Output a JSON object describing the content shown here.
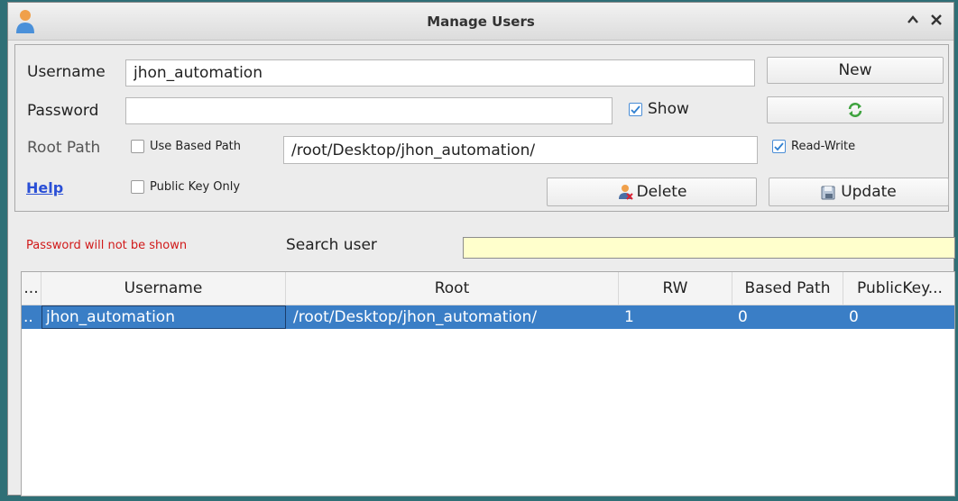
{
  "window": {
    "title": "Manage Users",
    "controls": {
      "shade": "^",
      "close": "x"
    }
  },
  "form": {
    "username_label": "Username",
    "username_value": "jhon_automation",
    "password_label": "Password",
    "password_value": "",
    "show_label": "Show",
    "show_checked": true,
    "root_path_label": "Root Path",
    "use_based_path_label": "Use Based Path",
    "use_based_path_checked": false,
    "root_path_value": "/root/Desktop/jhon_automation/",
    "read_write_label": "Read-Write",
    "read_write_checked": true,
    "public_key_only_label": "Public Key Only",
    "public_key_only_checked": false,
    "help_label": "Help"
  },
  "buttons": {
    "new_label": "New",
    "refresh_icon": "refresh-icon",
    "delete_label": "Delete",
    "update_label": "Update"
  },
  "search": {
    "warning": "Password will not be shown",
    "label": "Search user",
    "value": ""
  },
  "table": {
    "columns": [
      "...",
      "Username",
      "Root",
      "RW",
      "Based Path",
      "PublicKey..."
    ],
    "rows": [
      {
        "index": "..",
        "username": "jhon_automation",
        "root": "/root/Desktop/jhon_automation/",
        "rw": "1",
        "based_path": "0",
        "public_key": "0"
      }
    ]
  },
  "colors": {
    "selection": "#3a7ec6",
    "search_bg": "#ffffcc",
    "warning": "#d11a1a",
    "link": "#2a4fd6"
  }
}
